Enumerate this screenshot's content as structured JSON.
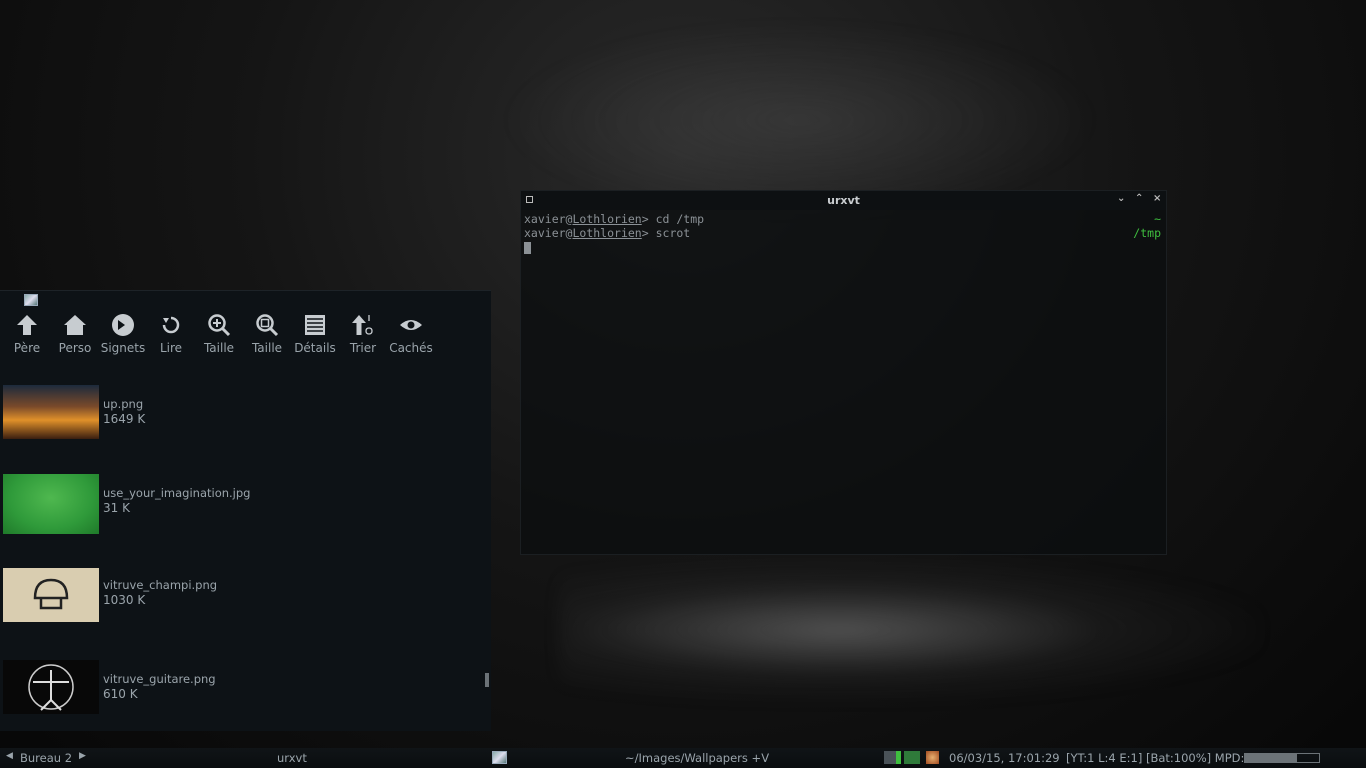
{
  "terminal": {
    "title": "urxvt",
    "lines": [
      {
        "user": "xavier",
        "at": "@",
        "host": "Lothlorien",
        "prompt": "> ",
        "command": "cd /tmp",
        "right": "~"
      },
      {
        "user": "xavier",
        "at": "@",
        "host": "Lothlorien",
        "prompt": "> ",
        "command": "scrot",
        "right": "/tmp"
      }
    ],
    "controls": {
      "minimize": "⌄",
      "maximize": "⌃",
      "close": "×"
    }
  },
  "filemanager": {
    "toolbar": [
      {
        "label": "Père",
        "icon": "up-arrow-icon"
      },
      {
        "label": "Perso",
        "icon": "home-icon"
      },
      {
        "label": "Signets",
        "icon": "bookmark-icon"
      },
      {
        "label": "Lire",
        "icon": "refresh-icon"
      },
      {
        "label": "Taille",
        "icon": "zoom-in-icon"
      },
      {
        "label": "Taille",
        "icon": "zoom-fit-icon"
      },
      {
        "label": "Détails",
        "icon": "details-icon"
      },
      {
        "label": "Trier",
        "icon": "sort-icon"
      },
      {
        "label": "Cachés",
        "icon": "eye-icon"
      }
    ],
    "files": [
      {
        "name": "up.png",
        "size": "1649  K"
      },
      {
        "name": "use_your_imagination.jpg",
        "size": "31  K"
      },
      {
        "name": "vitruve_champi.png",
        "size": "1030  K"
      },
      {
        "name": "vitruve_guitare.png",
        "size": "610  K"
      }
    ]
  },
  "taskbar": {
    "workspace": "Bureau 2",
    "active_window": "urxvt",
    "folder": "~/Images/Wallpapers +V",
    "datetime": "06/03/15, 17:01:29",
    "status": "[YT:1 L:4 E:1] [Bat:100%] MPD:",
    "mpd_progress": 0.7
  }
}
